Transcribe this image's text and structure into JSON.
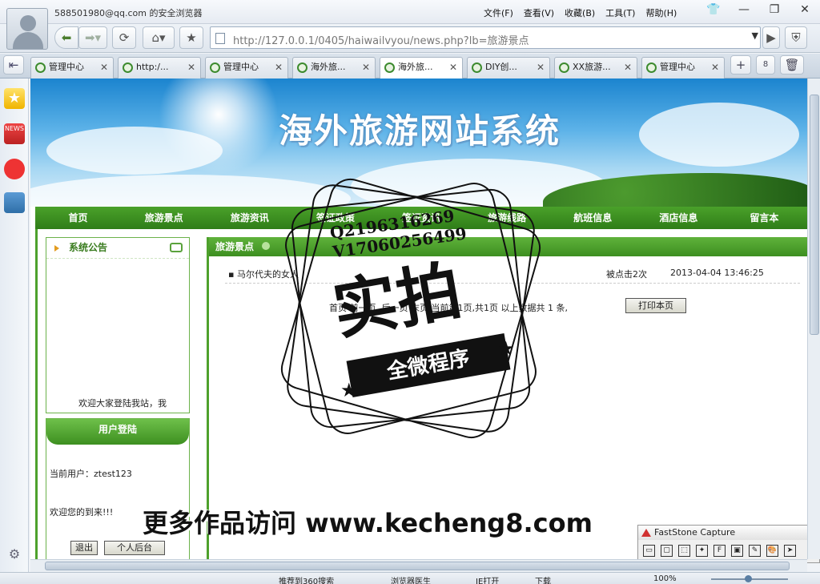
{
  "window": {
    "account": "588501980@qq.com 的安全浏览器",
    "menus": [
      "文件(F)",
      "查看(V)",
      "收藏(B)",
      "工具(T)",
      "帮助(H)"
    ]
  },
  "navbar": {
    "url": "http://127.0.0.1/0405/haiwailvyou/news.php?lb=旅游景点"
  },
  "tabs": [
    {
      "label": "管理中心",
      "active": false
    },
    {
      "label": "http:/...",
      "active": false
    },
    {
      "label": "管理中心",
      "active": false
    },
    {
      "label": "海外旅...",
      "active": false
    },
    {
      "label": "海外旅...",
      "active": true
    },
    {
      "label": "DIY创...",
      "active": false
    },
    {
      "label": "XX旅游...",
      "active": false
    },
    {
      "label": "管理中心",
      "active": false
    }
  ],
  "tab_count": "8",
  "site": {
    "title": "海外旅游网站系统",
    "nav": [
      "首页",
      "旅游景点",
      "旅游资讯",
      "签证政策",
      "签证资讯",
      "旅游线路",
      "航班信息",
      "酒店信息",
      "留言本"
    ],
    "notice": {
      "heading": "系统公告",
      "marquee": "欢迎大家登陆我站，我"
    },
    "login": {
      "heading": "用户登陆",
      "current_user": "当前用户：ztest123",
      "welcome": "欢迎您的到来!!!",
      "logout": "退出",
      "backend": "个人后台"
    },
    "main": {
      "heading": "旅游景点",
      "news": [
        {
          "title": "▪ 马尔代夫的女人",
          "clicks": "被点击2次",
          "date": "2013-04-04 13:46:25"
        }
      ],
      "pager": "首页 前一页 ,后一页 末页 当前第1页,共1页 以上数据共 1 条,",
      "print": "打印本页"
    }
  },
  "watermark": {
    "qq": "Q2196316269",
    "vx": "V17060256499",
    "big": "实拍",
    "ribbon": "全微程序",
    "bottom": "更多作品访问 www.kecheng8.com"
  },
  "faststone": {
    "title": "FastStone Capture",
    "tools": [
      "▭",
      "▢",
      "⬚",
      "✦",
      "F",
      "▣",
      "✎",
      "🎨",
      "➤"
    ]
  },
  "statusbar": {
    "recommend": "推荐到360搜索",
    "doctor": "浏览器医生",
    "ie": "IE打开",
    "download": "下载",
    "zoom": "100%"
  }
}
